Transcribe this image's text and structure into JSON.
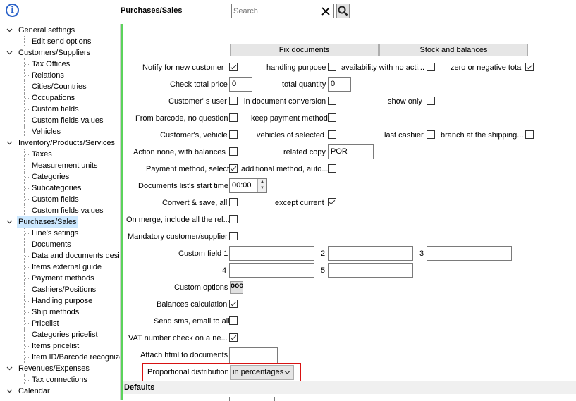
{
  "header": {
    "title": "Purchases/Sales",
    "search_placeholder": "Search",
    "clear_symbol": "✕"
  },
  "sidebar": {
    "items": [
      {
        "label": "General settings",
        "level": 0,
        "expanded": true
      },
      {
        "label": "Edit send options",
        "level": 1
      },
      {
        "label": "Customers/Suppliers",
        "level": 0,
        "expanded": true
      },
      {
        "label": "Tax Offices",
        "level": 1
      },
      {
        "label": "Relations",
        "level": 1
      },
      {
        "label": "Cities/Countries",
        "level": 1
      },
      {
        "label": "Occupations",
        "level": 1
      },
      {
        "label": "Custom fields",
        "level": 1
      },
      {
        "label": "Custom fields values",
        "level": 1
      },
      {
        "label": "Vehicles",
        "level": 1
      },
      {
        "label": "Inventory/Products/Services",
        "level": 0,
        "expanded": true
      },
      {
        "label": "Taxes",
        "level": 1
      },
      {
        "label": "Measurement units",
        "level": 1
      },
      {
        "label": "Categories",
        "level": 1
      },
      {
        "label": "Subcategories",
        "level": 1
      },
      {
        "label": "Custom fields",
        "level": 1
      },
      {
        "label": "Custom fields values",
        "level": 1
      },
      {
        "label": "Purchases/Sales",
        "level": 0,
        "expanded": true,
        "selected": true
      },
      {
        "label": "Line's setings",
        "level": 1
      },
      {
        "label": "Documents",
        "level": 1
      },
      {
        "label": "Data and documents desi",
        "level": 1
      },
      {
        "label": "Items external guide",
        "level": 1
      },
      {
        "label": "Payment methods",
        "level": 1
      },
      {
        "label": "Cashiers/Positions",
        "level": 1
      },
      {
        "label": "Handling purpose",
        "level": 1
      },
      {
        "label": "Ship methods",
        "level": 1
      },
      {
        "label": "Pricelist",
        "level": 1
      },
      {
        "label": "Categories pricelist",
        "level": 1
      },
      {
        "label": "Items pricelist",
        "level": 1
      },
      {
        "label": "Item ID/Barcode recognize",
        "level": 1
      },
      {
        "label": "Revenues/Expenses",
        "level": 0,
        "expanded": true
      },
      {
        "label": "Tax connections",
        "level": 1
      },
      {
        "label": "Calendar",
        "level": 0,
        "expanded": true
      }
    ]
  },
  "buttons": {
    "fix_documents": "Fix documents",
    "stock_and_balances": "Stock and balances"
  },
  "form": {
    "notify_new_customer": "Notify for new customer",
    "handling_purpose": "handling purpose",
    "availability_no_action": "availability with no acti...",
    "zero_negative_total": "zero or negative total",
    "check_total_price": "Check total price",
    "check_total_price_value": "0",
    "total_quantity": "total quantity",
    "total_quantity_value": "0",
    "customers_user": "Customer' s user",
    "in_document_conversion": "in document conversion",
    "show_only": "show only",
    "from_barcode": "From barcode, no question",
    "keep_payment_method": "keep payment method",
    "customers_vehicle": "Customer's, vehicle",
    "vehicles_of_selected": "vehicles of selected",
    "last_cashier": "last cashier",
    "branch_at_shipping": "branch at the shipping...",
    "action_none_balances": "Action none, with balances",
    "related_copy": "related copy",
    "related_copy_value": "POR",
    "payment_method_select": "Payment method, select",
    "additional_method": "additional method, auto...",
    "documents_start_time": "Documents list's start time",
    "documents_start_time_value": "00:00",
    "convert_save_all": "Convert & save, all",
    "except_current": "except current",
    "on_merge": "On merge, include all the rel...",
    "mandatory_customer": "Mandatory customer/supplier",
    "custom_field_1": "Custom field 1",
    "custom_field_num_2": "2",
    "custom_field_num_3": "3",
    "custom_field_num_4": "4",
    "custom_field_num_5": "5",
    "custom_options": "Custom options",
    "custom_options_btn": "ooo",
    "balances_calculation": "Balances calculation",
    "send_sms_email": "Send sms, email to all",
    "vat_number_check": "VAT number check on a ne...",
    "attach_html": "Attach html to documents",
    "proportional_distribution": "Proportional distribution",
    "proportional_distribution_value": "in percentages",
    "defaults": "Defaults"
  }
}
